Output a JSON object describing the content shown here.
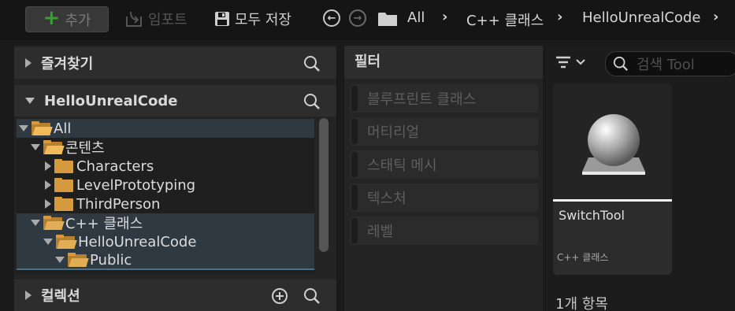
{
  "toolbar": {
    "add_label": "추가",
    "import_label": "임포트",
    "save_all_label": "모두 저장",
    "breadcrumbs": [
      "All",
      "C++ 클래스",
      "HelloUnrealCode"
    ]
  },
  "left_panel": {
    "favorites_label": "즐겨찾기",
    "project_label": "HelloUnrealCode",
    "collections_label": "컬렉션",
    "tree": [
      {
        "label": "All"
      },
      {
        "label": "콘텐츠"
      },
      {
        "label": "Characters"
      },
      {
        "label": "LevelPrototyping"
      },
      {
        "label": "ThirdPerson"
      },
      {
        "label": "C++ 클래스"
      },
      {
        "label": "HelloUnrealCode"
      },
      {
        "label": "Public"
      }
    ]
  },
  "filter_panel": {
    "title": "필터",
    "items": [
      "블루프린트 클래스",
      "머티리얼",
      "스태틱 메시",
      "텍스처",
      "레벨"
    ]
  },
  "assets": {
    "search_placeholder": "검색 Tool",
    "tile_name": "SwitchTool",
    "tile_type": "C++ 클래스",
    "count_label": "1개 항목"
  },
  "colors": {
    "folder": "#d59a3e",
    "add_plus": "#3f9a39",
    "selection": "#2f3942"
  }
}
